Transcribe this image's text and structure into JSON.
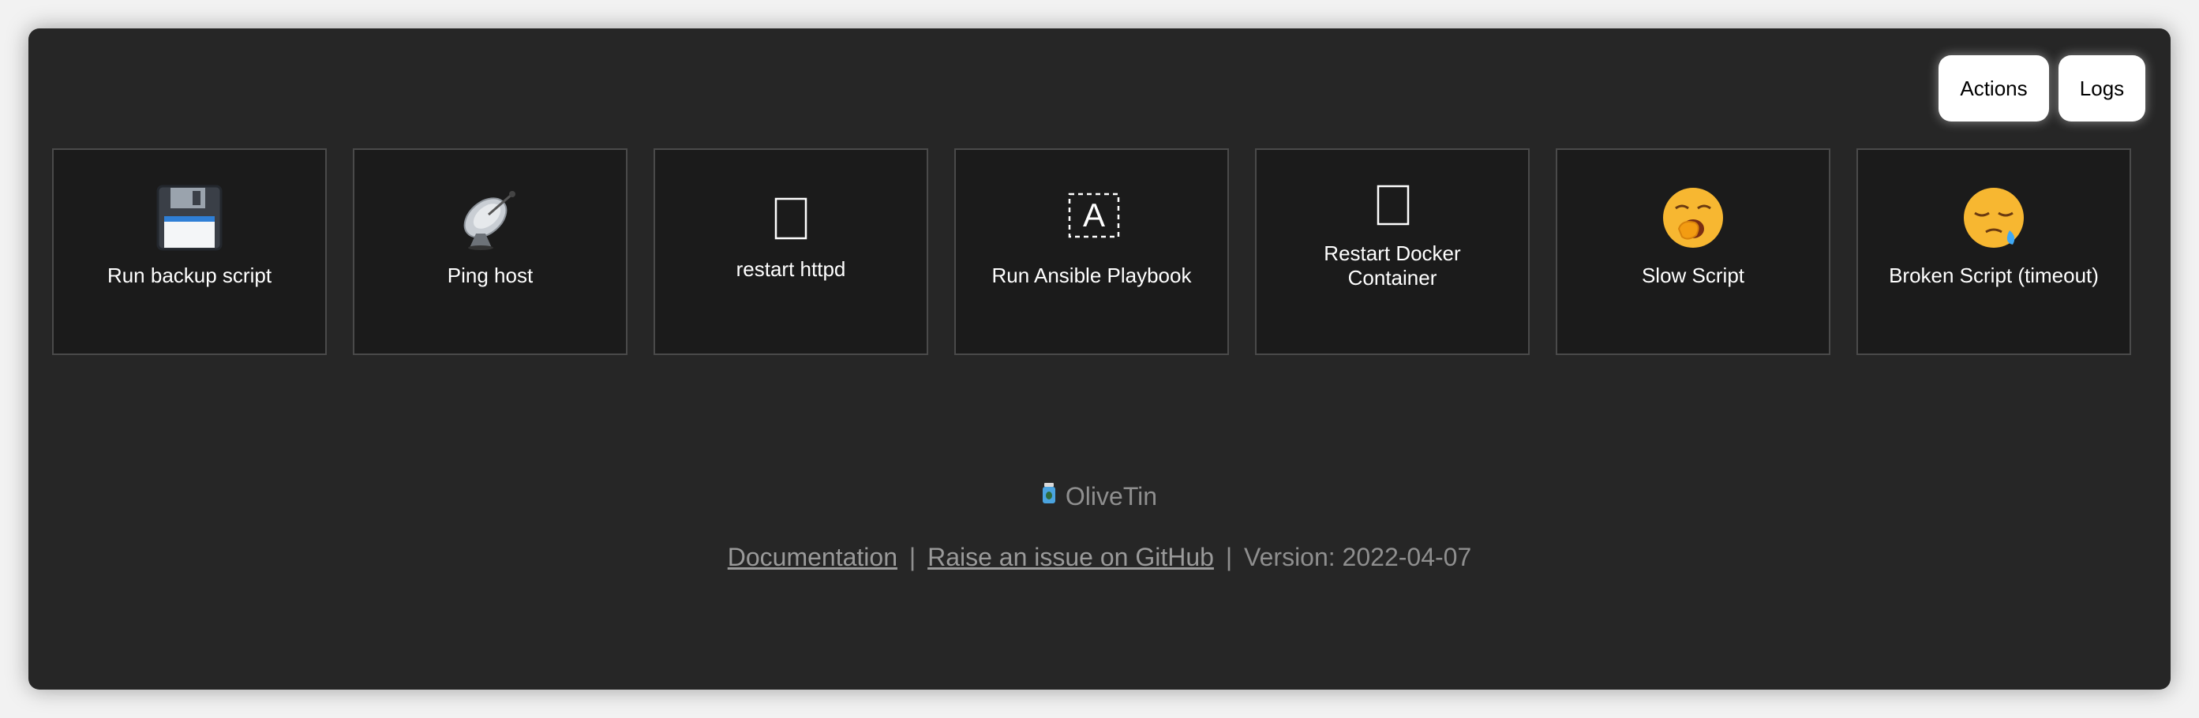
{
  "header": {
    "buttons": [
      {
        "label": "Actions"
      },
      {
        "label": "Logs"
      }
    ]
  },
  "actions": [
    {
      "label": "Run backup script",
      "icon": "floppy-disk-icon"
    },
    {
      "label": "Ping host",
      "icon": "satellite-dish-icon"
    },
    {
      "label": "restart httpd",
      "icon": "missing-glyph-icon"
    },
    {
      "label": "Run Ansible Playbook",
      "icon": "dashed-box-a-icon"
    },
    {
      "label": "Restart Docker Container",
      "icon": "missing-glyph-icon"
    },
    {
      "label": "Slow Script",
      "icon": "yawning-face-icon"
    },
    {
      "label": "Broken Script (timeout)",
      "icon": "sleepy-face-icon"
    }
  ],
  "footer": {
    "brand": "OliveTin",
    "documentation_link": "Documentation",
    "separator": "|",
    "github_link": "Raise an issue on GitHub",
    "version": "Version: 2022-04-07"
  },
  "colors": {
    "window_bg": "#262626",
    "tile_bg": "#1b1b1b",
    "tile_border": "#4a4a4a",
    "footer_text": "#8f8f8f"
  }
}
